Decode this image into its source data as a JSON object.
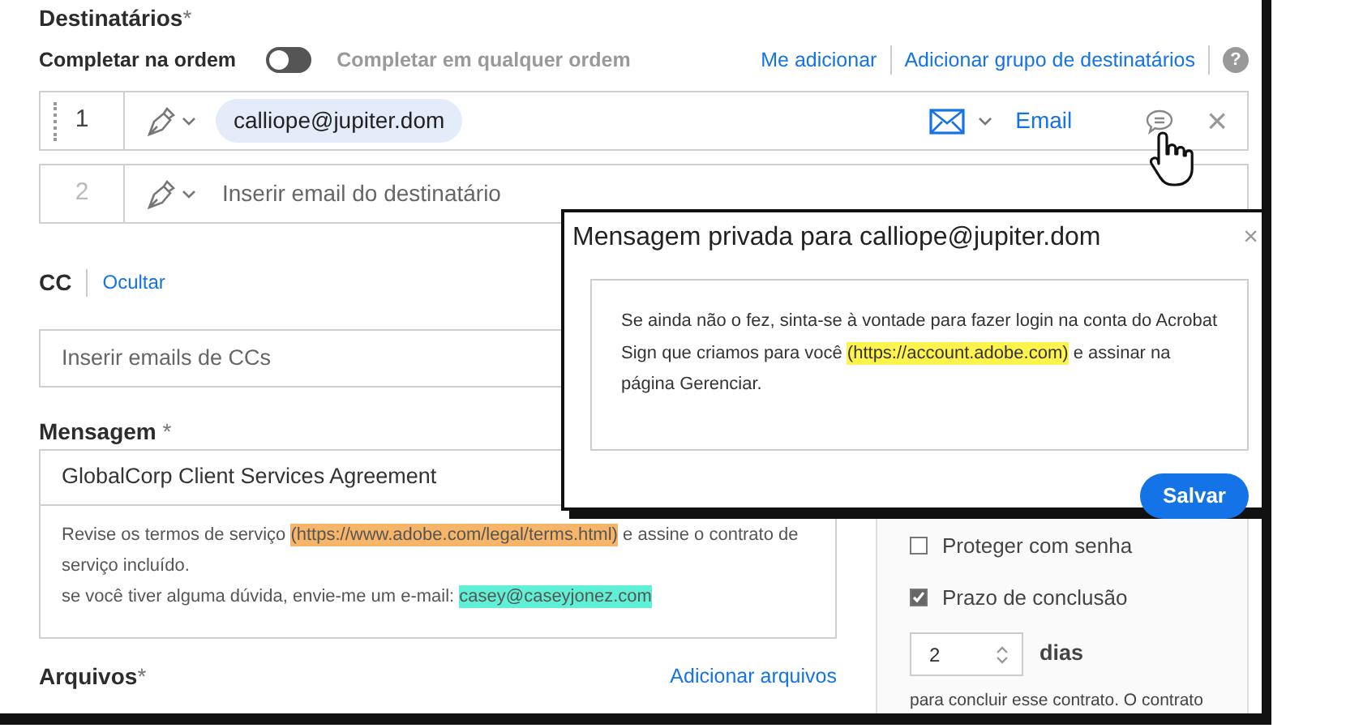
{
  "recipients": {
    "label": "Destinatários",
    "required_mark": "*",
    "order_label": "Completar na ordem",
    "toggle_on": false,
    "any_order_label": "Completar em qualquer ordem",
    "links": [
      "Me adicionar",
      "Adicionar grupo de destinatários"
    ],
    "help": "?",
    "rows": [
      {
        "kind": "filled",
        "number": "1",
        "email": "calliope@jupiter.dom",
        "delivery": "Email",
        "remove": "×"
      },
      {
        "kind": "empty",
        "number": "2",
        "placeholder": "Inserir email do destinatário"
      }
    ]
  },
  "cc": {
    "label": "CC",
    "toggle_link": "Ocultar",
    "placeholder": "Inserir emails de CCs"
  },
  "message": {
    "label": "Mensagem",
    "required_mark": "*",
    "subject": "GlobalCorp Client Services Agreement",
    "body": [
      [
        {
          "text": "Revise os termos de serviço "
        },
        {
          "text": "(https://www.adobe.com/legal/terms.html)",
          "color": "#f7b56a"
        },
        {
          "text": " e assine o contrato de serviço incluído."
        }
      ],
      [
        {
          "text": "se você tiver alguma dúvida, envie-me um e-mail: "
        },
        {
          "text": "casey@caseyjonez.com",
          "color": "#5ff0d6"
        }
      ]
    ]
  },
  "files": {
    "label": "Arquivos",
    "required_mark": "*",
    "link": "Adicionar arquivos"
  },
  "options": [
    {
      "label": "Proteger com senha",
      "checked": false
    },
    {
      "label": "Prazo de conclusão",
      "checked": true
    }
  ],
  "deadline": {
    "value": "2",
    "unit": "dias",
    "note": "para concluir esse contrato. O contrato"
  },
  "dialog": {
    "title": "Mensagem privada para calliope@jupiter.dom",
    "close": "×",
    "body": [
      {
        "text": "Se ainda não o fez, sinta-se à vontade para fazer login na conta do Acrobat Sign que criamos para você "
      },
      {
        "text": "(https://account.adobe.com)",
        "color": "#fff34d"
      },
      {
        "text": " e assinar na página Gerenciar."
      }
    ],
    "save": "Salvar"
  }
}
